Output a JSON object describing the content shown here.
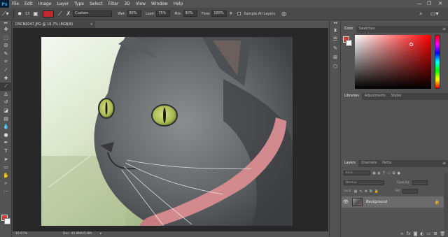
{
  "app": {
    "logo": "Ps"
  },
  "menu": [
    "File",
    "Edit",
    "Image",
    "Layer",
    "Type",
    "Select",
    "Filter",
    "3D",
    "View",
    "Window",
    "Help"
  ],
  "window_controls": {
    "minimize": "—",
    "restore": "❐",
    "close": "✕"
  },
  "options_bar": {
    "brush_size": "13",
    "mode_value": "Custom",
    "wet_label": "Wet:",
    "wet_value": "80%",
    "load_label": "Load:",
    "load_value": "75%",
    "mix_label": "Mix:",
    "mix_value": "90%",
    "flow_label": "Flow:",
    "flow_value": "100%",
    "sample_all_layers": "Sample All Layers",
    "accent_color": "#c1272d"
  },
  "document": {
    "tab_title": "DSCN0047.JPG @ 16.7% (RGB/8)",
    "zoom": "16.67%",
    "doc_info": "Doc: 45.8M/45.8M"
  },
  "color_panel": {
    "tabs": [
      "Color",
      "Swatches"
    ],
    "foreground": "#e03030",
    "background": "#ffffff"
  },
  "libraries_panel": {
    "tabs": [
      "Libraries",
      "Adjustments",
      "Styles"
    ]
  },
  "layers_panel": {
    "tabs": [
      "Layers",
      "Channels",
      "Paths"
    ],
    "kind_filter": "Kind",
    "blend_mode": "Normal",
    "opacity_label": "Opacity:",
    "lock_label": "Lock:",
    "fill_label": "Fill:",
    "layer_name": "Background"
  }
}
